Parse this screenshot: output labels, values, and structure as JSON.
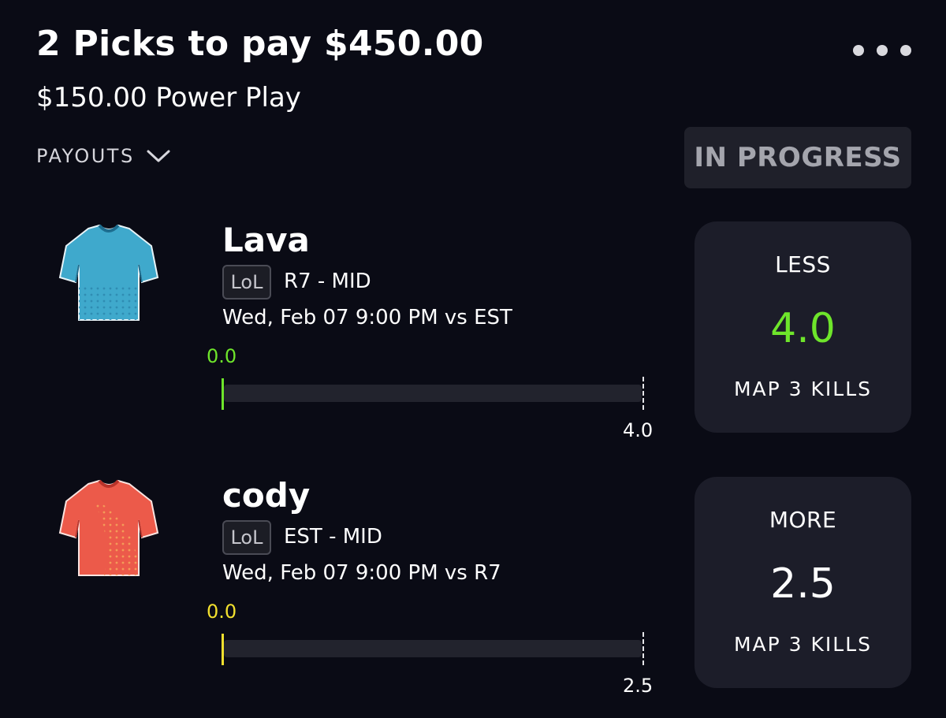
{
  "header": {
    "title": "2 Picks to pay $450.00",
    "subtitle": "$150.00 Power Play",
    "payouts_label": "PAYOUTS",
    "status": "IN PROGRESS"
  },
  "colors": {
    "background": "#0a0b15",
    "card": "#1c1d29",
    "green": "#6ee52b",
    "yellow": "#f2e02e",
    "jersey_blue": "#3fa9cc",
    "jersey_red": "#ec5a4a"
  },
  "picks": [
    {
      "player": "Lava",
      "league": "LoL",
      "team_position": "R7 - MID",
      "game_time": "Wed, Feb 07 9:00 PM  vs EST",
      "current": "0.0",
      "target": "4.0",
      "progress": 0,
      "direction": "LESS",
      "line": "4.0",
      "stat": "MAP 3 KILLS",
      "jersey_icon": "jersey-blue-icon",
      "accent": "#6ee52b"
    },
    {
      "player": "cody",
      "league": "LoL",
      "team_position": "EST - MID",
      "game_time": "Wed, Feb 07 9:00 PM  vs R7",
      "current": "0.0",
      "target": "2.5",
      "progress": 0,
      "direction": "MORE",
      "line": "2.5",
      "stat": "MAP 3 KILLS",
      "jersey_icon": "jersey-red-icon",
      "accent": "#f2e02e"
    }
  ]
}
